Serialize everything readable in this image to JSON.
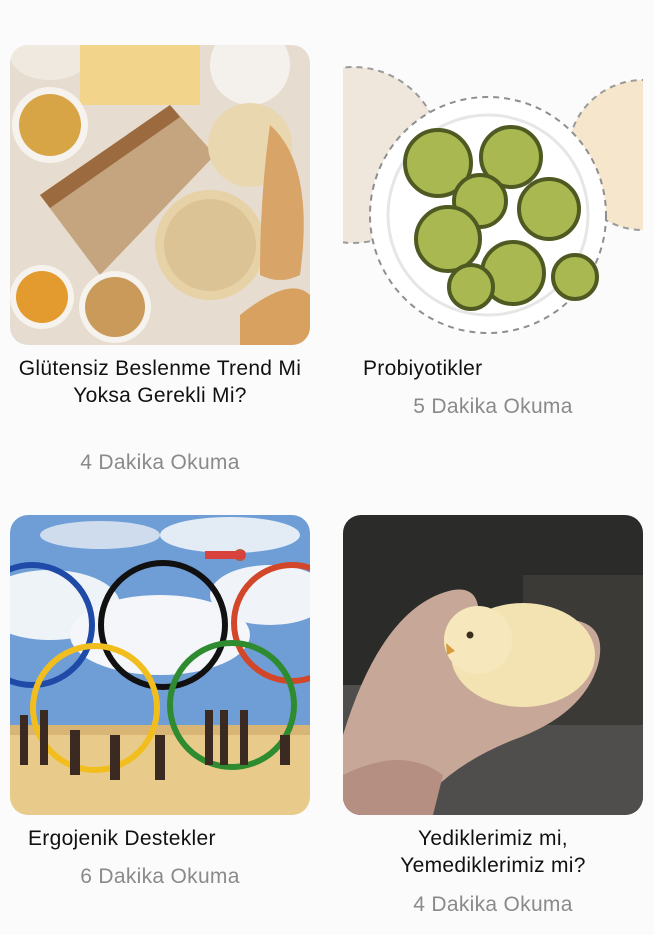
{
  "articles": [
    {
      "title": "Glütensiz Beslenme Trend Mi Yoksa Gerekli Mi?",
      "meta": "4 Dakika Okuma",
      "image": "gluten-free-food-image"
    },
    {
      "title": "Probiyotikler",
      "meta": "5 Dakika Okuma",
      "image": "pickles-bowl-image"
    },
    {
      "title": "Ergojenik Destekler",
      "meta": "6 Dakika Okuma",
      "image": "olympic-athletes-image"
    },
    {
      "title": "Yediklerimiz mi, Yemediklerimiz mi?",
      "meta": "4 Dakika Okuma",
      "image": "chick-in-hand-image"
    }
  ]
}
